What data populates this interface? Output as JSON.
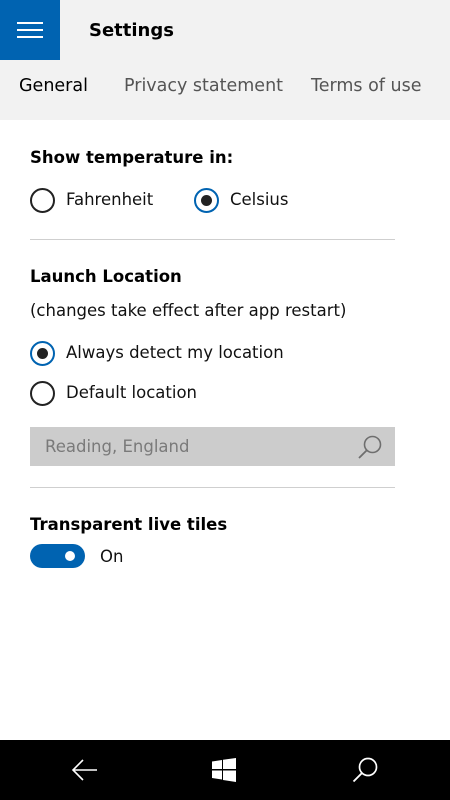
{
  "header": {
    "menu_icon": "hamburger-menu-icon",
    "title": "Settings",
    "accent_color": "#0063b1",
    "background_color": "#f2f2f2"
  },
  "tabs": [
    {
      "label": "General",
      "active": true
    },
    {
      "label": "Privacy statement",
      "active": false
    },
    {
      "label": "Terms of use",
      "active": false
    }
  ],
  "temperature": {
    "title": "Show temperature in:",
    "options": [
      {
        "label": "Fahrenheit",
        "checked": false
      },
      {
        "label": "Celsius",
        "checked": true
      }
    ]
  },
  "launch_location": {
    "title": "Launch Location",
    "note": "(changes take effect after app restart)",
    "options": [
      {
        "label": "Always detect my location",
        "checked": true
      },
      {
        "label": "Default location",
        "checked": false
      }
    ],
    "search_placeholder": "Reading, England",
    "search_icon": "search-icon"
  },
  "live_tiles": {
    "title": "Transparent live tiles",
    "toggle_state": "On",
    "toggle_on": true
  },
  "navbar": {
    "background_color": "#000000",
    "buttons": [
      {
        "icon": "back-arrow-icon"
      },
      {
        "icon": "windows-logo-icon"
      },
      {
        "icon": "search-icon"
      }
    ]
  }
}
